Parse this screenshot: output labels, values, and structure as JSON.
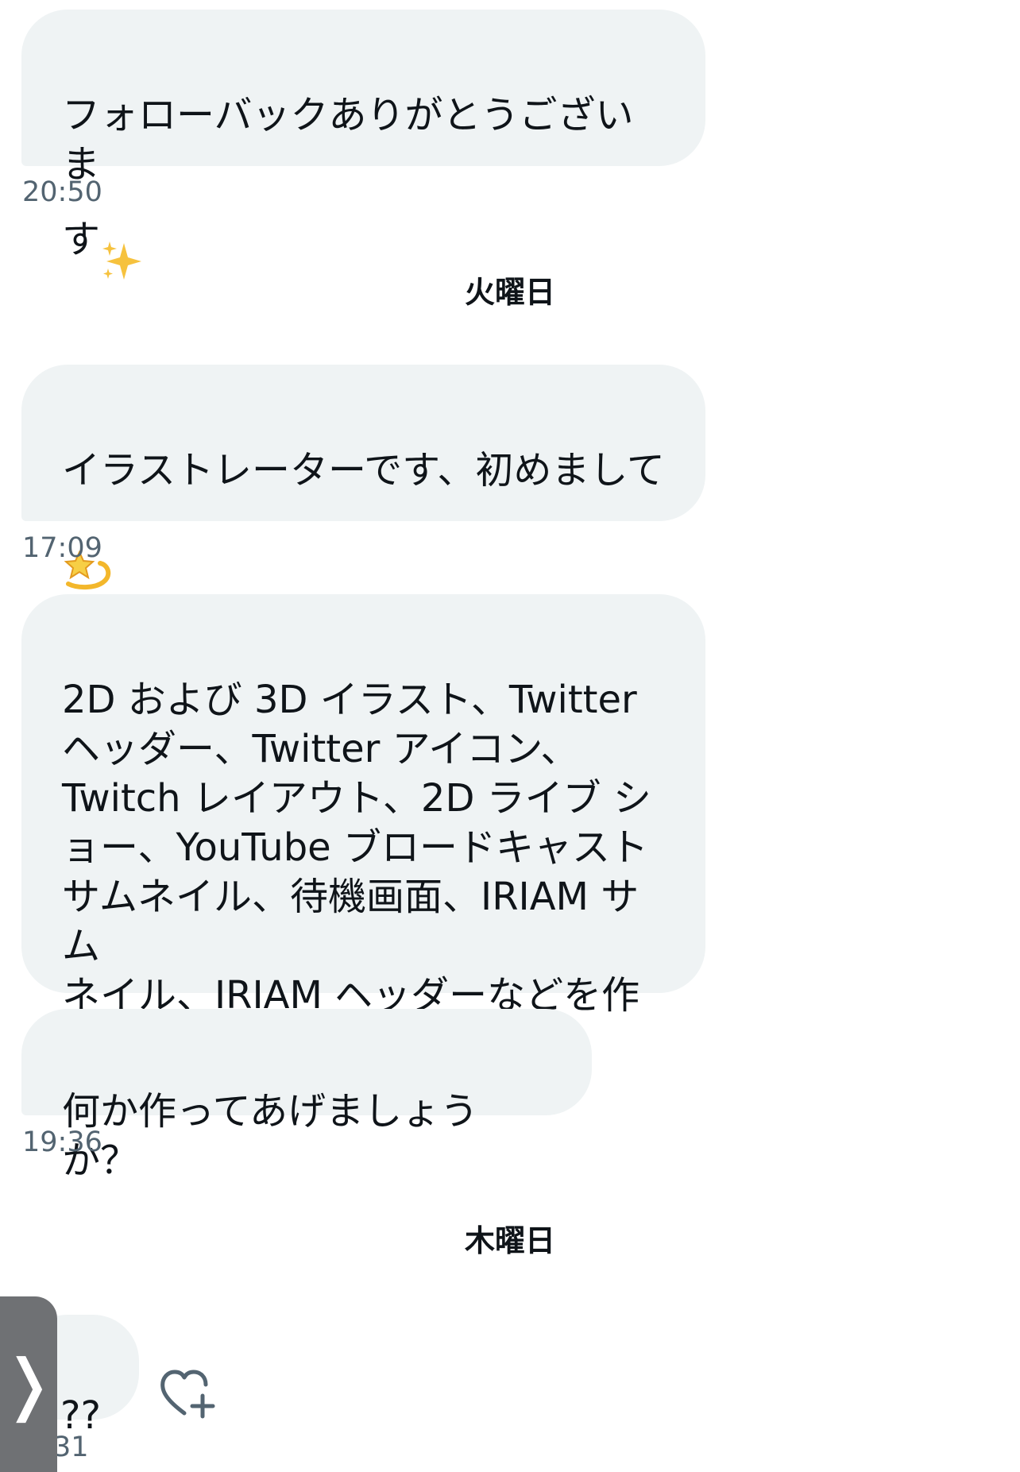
{
  "messages": [
    {
      "text": "フォローバックありがとうございま\nす",
      "emoji": "sparkles-emoji",
      "time": "20:50"
    },
    {
      "day_separator": "火曜日"
    },
    {
      "text": "イラストレーターです、初めまして\n",
      "emoji": "dizzy-emoji",
      "time": "17:09"
    },
    {
      "text": "2D および 3D イラスト、Twitter\nヘッダー、Twitter アイコン、\nTwitch レイアウト、2D ライブ シ\nョー、YouTube ブロードキャスト\nサムネイル、待機画面、IRIAM サム\nネイル、IRIAM ヘッダーなどを作成\nできます。"
    },
    {
      "text": "何か作ってあげましょうか？",
      "time": "19:36"
    },
    {
      "day_separator": "木曜日"
    },
    {
      "text": "??",
      "time": "31"
    }
  ],
  "icons": {
    "like": "heart-plus-icon",
    "handle": "chevron-right-icon"
  },
  "handle_glyph": "❭",
  "colors": {
    "bubble": "#eff3f4",
    "timestamp": "#536471",
    "text": "#0f1419",
    "handle": "#6f7174"
  }
}
